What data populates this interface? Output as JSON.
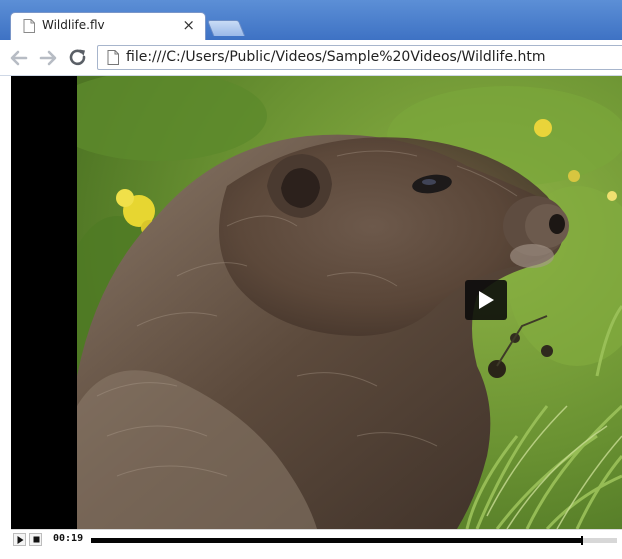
{
  "browser": {
    "tab": {
      "title": "Wildlife.flv",
      "close_glyph": "×"
    },
    "address_bar": {
      "url": "file:///C:/Users/Public/Videos/Sample%20Videos/Wildlife.htm"
    },
    "icons": {
      "back": "arrow-left-icon",
      "forward": "arrow-right-icon",
      "reload": "reload-icon",
      "page": "page-icon"
    }
  },
  "player": {
    "time": "00:19",
    "progress_fraction": 0.934,
    "icons": {
      "play": "play-icon",
      "stop": "stop-icon",
      "overlay": "play-overlay-icon"
    }
  },
  "colors": {
    "titlebar": "#4a80cf",
    "seek_track": "#d7d7d7",
    "seek_fill": "#050505",
    "letterbox": "#000000"
  }
}
